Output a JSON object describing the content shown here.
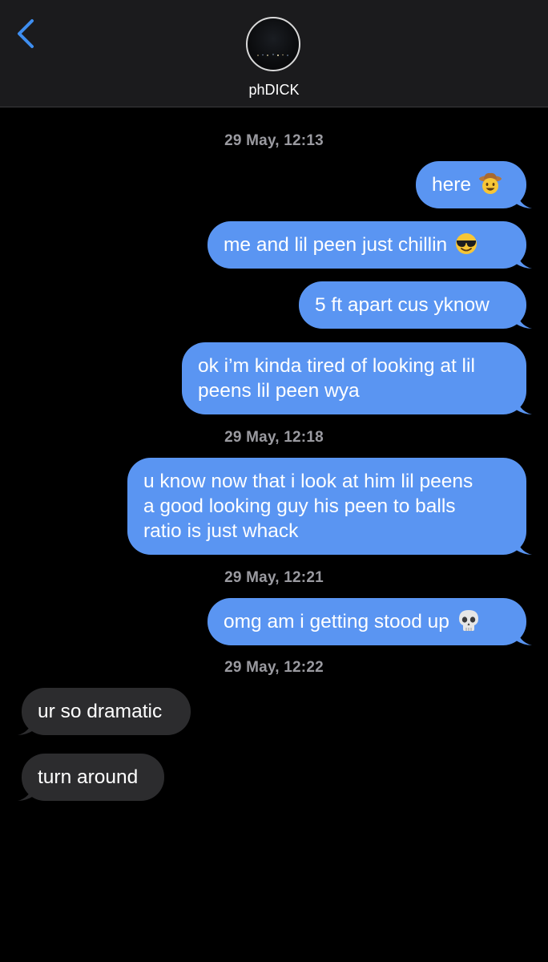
{
  "header": {
    "contact_name": "phDICK",
    "back_icon": "chevron-left-icon",
    "accent": "#3e8ef0"
  },
  "colors": {
    "sent_bubble": "#5a95f2",
    "received_bubble": "#2c2c2e",
    "timestamp": "#9a9aa0",
    "background": "#000000"
  },
  "conversation": [
    {
      "type": "timestamp",
      "text": "29 May, 12:13"
    },
    {
      "type": "sent",
      "text": "here",
      "emoji": "cowboy-face"
    },
    {
      "type": "sent",
      "text": "me and lil peen just chillin",
      "emoji": "sunglasses-face"
    },
    {
      "type": "sent",
      "text": "5 ft apart cus yknow"
    },
    {
      "type": "sent",
      "text": "ok i’m kinda tired of looking at lil\npeens lil peen wya"
    },
    {
      "type": "timestamp",
      "text": "29 May, 12:18"
    },
    {
      "type": "sent",
      "text": "u know now that i look at him lil peens\na good looking guy his peen to balls\nratio is just whack"
    },
    {
      "type": "timestamp",
      "text": "29 May, 12:21"
    },
    {
      "type": "sent",
      "text": "omg am i getting stood up",
      "emoji": "skull"
    },
    {
      "type": "timestamp",
      "text": "29 May, 12:22"
    },
    {
      "type": "received",
      "text": "ur so dramatic"
    },
    {
      "type": "received",
      "text": "turn around"
    }
  ]
}
